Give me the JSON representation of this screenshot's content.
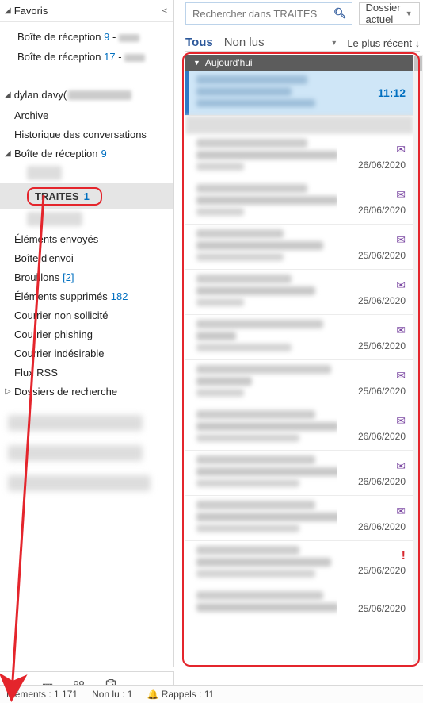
{
  "favorites": {
    "header": "Favoris",
    "items": [
      {
        "label": "Boîte de réception",
        "count": "9"
      },
      {
        "label": "Boîte de réception",
        "count": "17"
      }
    ]
  },
  "account": {
    "name": "dylan.davy("
  },
  "folders": {
    "archive": "Archive",
    "hist": "Historique des conversations",
    "inbox": {
      "label": "Boîte de réception",
      "count": "9"
    },
    "traites": {
      "label": "TRAITES",
      "count": "1"
    },
    "sent": "Éléments envoyés",
    "outbox": "Boîte d'envoi",
    "drafts": {
      "label": "Brouillons",
      "extra": "[2]"
    },
    "deleted": {
      "label": "Éléments supprimés",
      "count": "182"
    },
    "junk": "Courrier non sollicité",
    "phish": "Courrier phishing",
    "spam": "Courrier indésirable",
    "rss": "Flux RSS",
    "search": "Dossiers de recherche"
  },
  "search": {
    "placeholder": "Rechercher dans TRAITES",
    "scope": "Dossier actuel"
  },
  "filter": {
    "all": "Tous",
    "unread": "Non lus",
    "sort": "Le plus récent"
  },
  "group": {
    "today": "Aujourd'hui"
  },
  "messages": {
    "selected_time": "11:12",
    "dates": [
      "26/06/2020",
      "26/06/2020",
      "25/06/2020",
      "25/06/2020",
      "25/06/2020",
      "25/06/2020",
      "26/06/2020",
      "26/06/2020",
      "26/06/2020",
      "25/06/2020",
      "25/06/2020"
    ]
  },
  "status": {
    "elements_label": "Éléments :",
    "elements_value": "1 171",
    "unread_label": "Non lu :",
    "unread_value": "1",
    "reminders_label": "Rappels :",
    "reminders_value": "11"
  }
}
